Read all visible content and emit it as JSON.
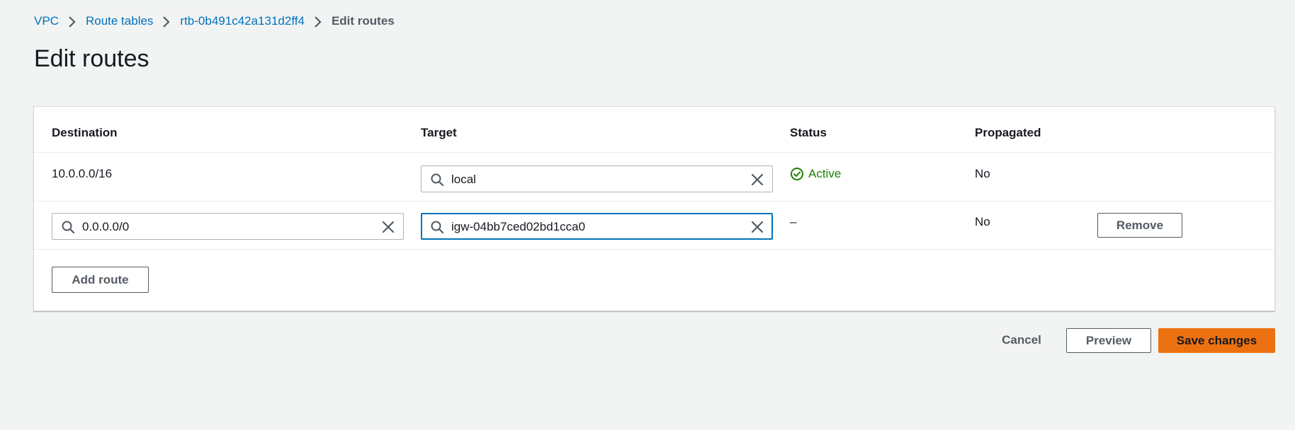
{
  "breadcrumb": {
    "items": [
      "VPC",
      "Route tables",
      "rtb-0b491c42a131d2ff4"
    ],
    "current": "Edit routes"
  },
  "page_title": "Edit routes",
  "table": {
    "headers": {
      "destination": "Destination",
      "target": "Target",
      "status": "Status",
      "propagated": "Propagated"
    },
    "rows": [
      {
        "destination": "10.0.0.0/16",
        "target": "local",
        "status": "Active",
        "propagated": "No"
      },
      {
        "destination": "0.0.0.0/0",
        "target": "igw-04bb7ced02bd1cca0",
        "status": "–",
        "propagated": "No",
        "remove_label": "Remove"
      }
    ],
    "add_route_label": "Add route"
  },
  "footer": {
    "cancel_label": "Cancel",
    "preview_label": "Preview",
    "save_label": "Save changes"
  },
  "colors": {
    "link": "#0073bb",
    "status_active": "#1d8102",
    "primary_button": "#ec7211",
    "focus_border": "#0073bb"
  },
  "icons": {
    "breadcrumb_separator": "chevron-right-icon",
    "search": "search-icon",
    "clear": "close-icon",
    "status": "check-circle-icon"
  }
}
